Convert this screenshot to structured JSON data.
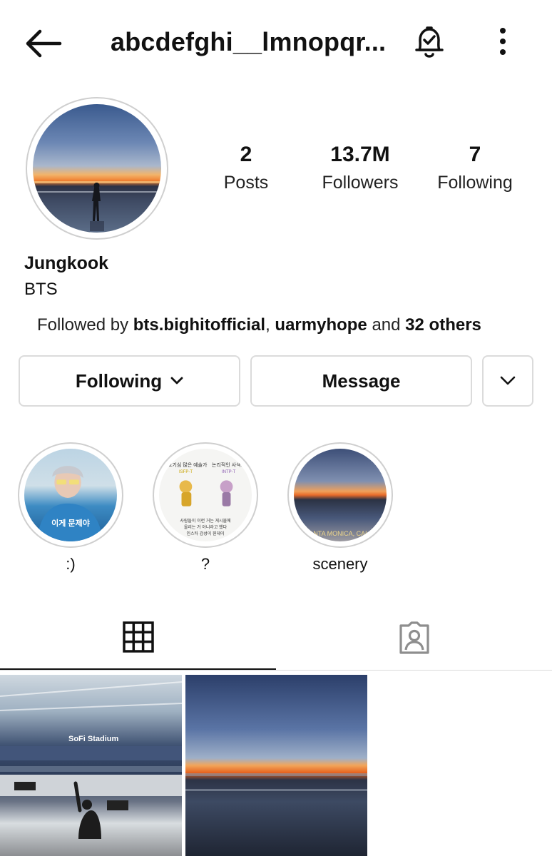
{
  "header": {
    "username": "abcdefghi__lmnopqr...",
    "icons": {
      "back": "arrow-left-icon",
      "notifications": "bell-check-icon",
      "more": "more-vertical-icon"
    }
  },
  "profile": {
    "name": "Jungkook",
    "bio": "BTS",
    "stats": [
      {
        "value": "2",
        "label": "Posts"
      },
      {
        "value": "13.7M",
        "label": "Followers"
      },
      {
        "value": "7",
        "label": "Following"
      }
    ],
    "followed_by": {
      "prefix": "Followed by ",
      "user1": "bts.bighitofficial",
      "sep": ", ",
      "user2": "uarmyhope",
      "and": " and ",
      "others": "32 others"
    }
  },
  "actions": {
    "following_label": "Following",
    "message_label": "Message"
  },
  "highlights": [
    {
      "label": ":)",
      "inner_text": "이게 문제야"
    },
    {
      "label": "?",
      "top_left": "호기심 많은 예술가",
      "top_right": "논리적인 사색가",
      "tag_left": "ISFP-T",
      "tag_right": "INTP-T",
      "line1": "사람들이 이런 거는 게시물에",
      "line2": "올리는 거 아니라고 했다",
      "line3": "인스타 감성이 뭔데이"
    },
    {
      "label": "scenery",
      "inner_text": "SANTA MONICA, CALIF."
    }
  ],
  "tabs": {
    "grid_icon": "grid-icon",
    "tagged_icon": "tagged-person-icon"
  },
  "posts": [
    {
      "overlay_text": "SoFi Stadium"
    },
    {
      "overlay_text": ""
    }
  ]
}
